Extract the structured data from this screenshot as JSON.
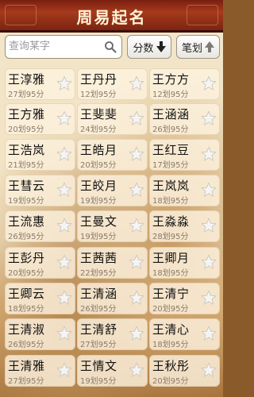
{
  "header": {
    "title": "周易起名"
  },
  "search": {
    "placeholder": "查询某字",
    "icon": "search-icon"
  },
  "sort_buttons": {
    "score": {
      "label": "分数",
      "icon": "arrow-down-icon"
    },
    "stroke": {
      "label": "笔划",
      "icon": "arrow-up-icon"
    }
  },
  "names": [
    {
      "name": "王淳雅",
      "info": "27划95分"
    },
    {
      "name": "王丹丹",
      "info": "12划95分"
    },
    {
      "name": "王方方",
      "info": "12划95分"
    },
    {
      "name": "王方雅",
      "info": "20划95分"
    },
    {
      "name": "王斐斐",
      "info": "24划95分"
    },
    {
      "name": "王涵涵",
      "info": "26划95分"
    },
    {
      "name": "王浩岚",
      "info": "21划95分"
    },
    {
      "name": "王皓月",
      "info": "20划95分"
    },
    {
      "name": "王红豆",
      "info": "17划95分"
    },
    {
      "name": "王彗云",
      "info": "19划95分"
    },
    {
      "name": "王皎月",
      "info": "19划95分"
    },
    {
      "name": "王岚岚",
      "info": "18划95分"
    },
    {
      "name": "王流惠",
      "info": "26划95分"
    },
    {
      "name": "王曼文",
      "info": "19划95分"
    },
    {
      "name": "王淼淼",
      "info": "28划95分"
    },
    {
      "name": "王彭丹",
      "info": "20划95分"
    },
    {
      "name": "王茜茜",
      "info": "22划95分"
    },
    {
      "name": "王卿月",
      "info": "18划95分"
    },
    {
      "name": "王卿云",
      "info": "18划95分"
    },
    {
      "name": "王清涵",
      "info": "26划95分"
    },
    {
      "name": "王清宁",
      "info": "20划95分"
    },
    {
      "name": "王清淑",
      "info": "26划95分"
    },
    {
      "name": "王清舒",
      "info": "27划95分"
    },
    {
      "name": "王清心",
      "info": "18划95分"
    },
    {
      "name": "王清雅",
      "info": "27划95分"
    },
    {
      "name": "王情文",
      "info": "19划95分"
    },
    {
      "name": "王秋彤",
      "info": "20划95分"
    }
  ],
  "colors": {
    "header_bg": "#a63a1c",
    "star": "#f2f2f2"
  }
}
